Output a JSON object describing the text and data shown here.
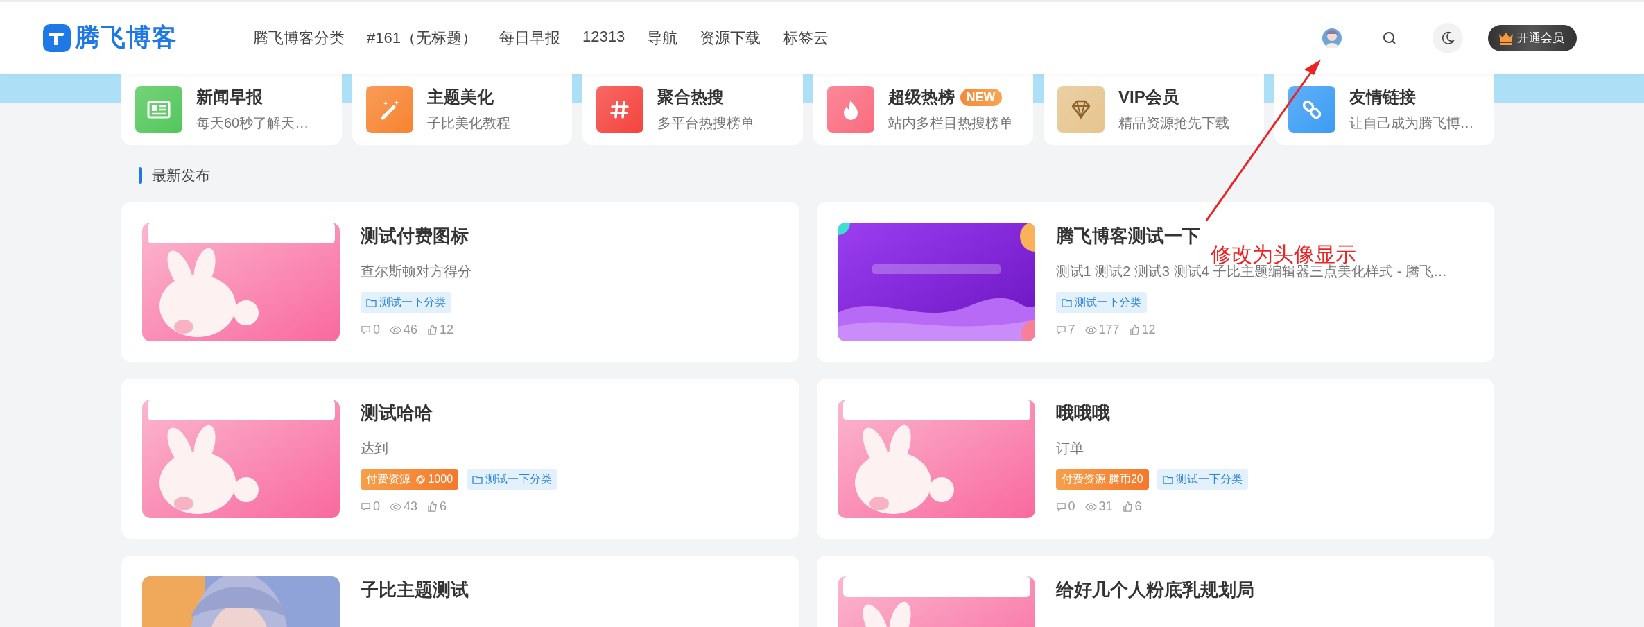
{
  "header": {
    "logo": "腾飞博客",
    "nav": [
      {
        "label": "腾飞博客分类"
      },
      {
        "label": "#161（无标题）"
      },
      {
        "label": "每日早报"
      },
      {
        "label": "12313"
      },
      {
        "label": "导航"
      },
      {
        "label": "资源下载"
      },
      {
        "label": "标签云"
      }
    ],
    "vip_button": "开通会员"
  },
  "categories": [
    {
      "kind": "news",
      "title": "新闻早报",
      "subtitle": "每天60秒了解天…",
      "color": "#52c75a"
    },
    {
      "kind": "wand",
      "title": "主题美化",
      "subtitle": "子比美化教程",
      "color": "#f7832f"
    },
    {
      "kind": "hash",
      "title": "聚合热搜",
      "subtitle": "多平台热搜榜单",
      "color": "#f5433e"
    },
    {
      "kind": "fire",
      "title": "超级热榜",
      "badge": "NEW",
      "subtitle": "站内多栏目热搜榜单",
      "color": "#fa6b7f"
    },
    {
      "kind": "diamond",
      "title": "VIP会员",
      "subtitle": "精品资源抢先下载",
      "color": "#e6c48e"
    },
    {
      "kind": "link",
      "title": "友情链接",
      "subtitle": "让自己成为腾飞博…",
      "color": "#3a9cf5"
    }
  ],
  "section_title": "最新发布",
  "posts": [
    {
      "thumbnail": {
        "kind": "picture"
      },
      "title": "测试付费图标",
      "excerpt": "查尔斯顿对方得分",
      "tags": [
        {
          "kind": "category",
          "text": "测试一下分类"
        }
      ],
      "comments": "0",
      "views": "46",
      "likes": "12"
    },
    {
      "thumbnail": {
        "kind": "picture"
      },
      "title": "腾飞博客测试一下",
      "excerpt": "测试1 测试2 测试3 测试4 子比主题编辑器三点美化样式 - 腾飞…",
      "tags": [
        {
          "kind": "category",
          "text": "测试一下分类"
        }
      ],
      "comments": "7",
      "views": "177",
      "likes": "12"
    },
    {
      "thumbnail": {
        "kind": "picture"
      },
      "title": "测试哈哈",
      "excerpt": "达到",
      "tags": [
        {
          "kind": "paid",
          "label": "付费资源",
          "price": "1000",
          "coin_icon": true
        },
        {
          "kind": "category",
          "text": "测试一下分类"
        }
      ],
      "comments": "0",
      "views": "43",
      "likes": "6"
    },
    {
      "thumbnail": {
        "kind": "picture"
      },
      "title": "哦哦哦",
      "excerpt": "订单",
      "tags": [
        {
          "kind": "paid",
          "label": "付费资源",
          "price": "腾币20",
          "coin_icon": false
        },
        {
          "kind": "category",
          "text": "测试一下分类"
        }
      ],
      "comments": "0",
      "views": "31",
      "likes": "6"
    },
    {
      "thumbnail": {
        "kind": "picture"
      },
      "title": "子比主题测试"
    },
    {
      "thumbnail": {
        "kind": "picture"
      },
      "title": "给好几个人粉底乳规划局"
    }
  ],
  "annotation": {
    "text": "修改为头像显示"
  }
}
